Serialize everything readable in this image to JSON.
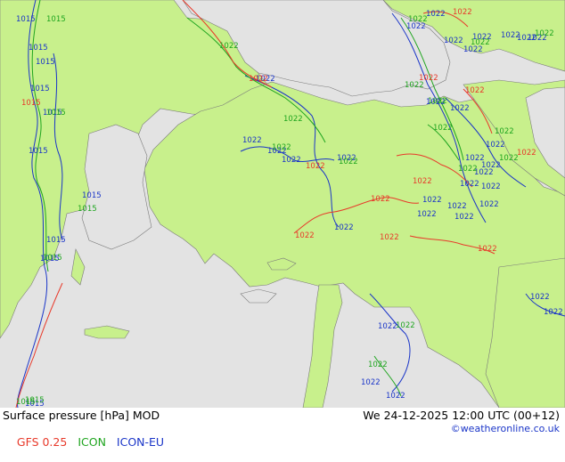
{
  "title": "Surface pressure [hPa] MOD",
  "datetime": "We 24-12-2025 12:00 UTC (00+12)",
  "credit": "©weatheronline.co.uk",
  "models": [
    {
      "label": "GFS 0.25",
      "color": "#e8392a"
    },
    {
      "label": "ICON",
      "color": "#1fa51f"
    },
    {
      "label": "ICON-EU",
      "color": "#1a35c8"
    }
  ],
  "colors": {
    "land": "#c8f08c",
    "sea": "#e3e3e3",
    "coast": "#7a7a7a"
  },
  "isobar_labels": {
    "blue": [
      "1015",
      "1015",
      "1015",
      "1015",
      "1015",
      "1015",
      "1015",
      "1015",
      "1015",
      "1015",
      "1022",
      "1022",
      "1022",
      "1022",
      "1022",
      "1022",
      "1022",
      "1022",
      "1022",
      "1022",
      "1022",
      "1022",
      "1022",
      "1022",
      "1022",
      "1022",
      "1022",
      "1022",
      "1022",
      "1022",
      "1022",
      "1022",
      "1022",
      "1022",
      "1022",
      "1022",
      "1022",
      "1022",
      "1022",
      "1022",
      "1022",
      "1022"
    ],
    "green": [
      "1015",
      "1015",
      "1015",
      "1015",
      "1015",
      "1015",
      "1022",
      "1022",
      "1022",
      "1022",
      "1022",
      "1022",
      "1022",
      "1022",
      "1022",
      "1022",
      "1022",
      "1022",
      "1022",
      "1022",
      "1022"
    ],
    "red": [
      "1015",
      "1022",
      "1022",
      "1022",
      "1022",
      "1022",
      "1022",
      "1022",
      "1022",
      "1022",
      "1022",
      "1022"
    ]
  }
}
